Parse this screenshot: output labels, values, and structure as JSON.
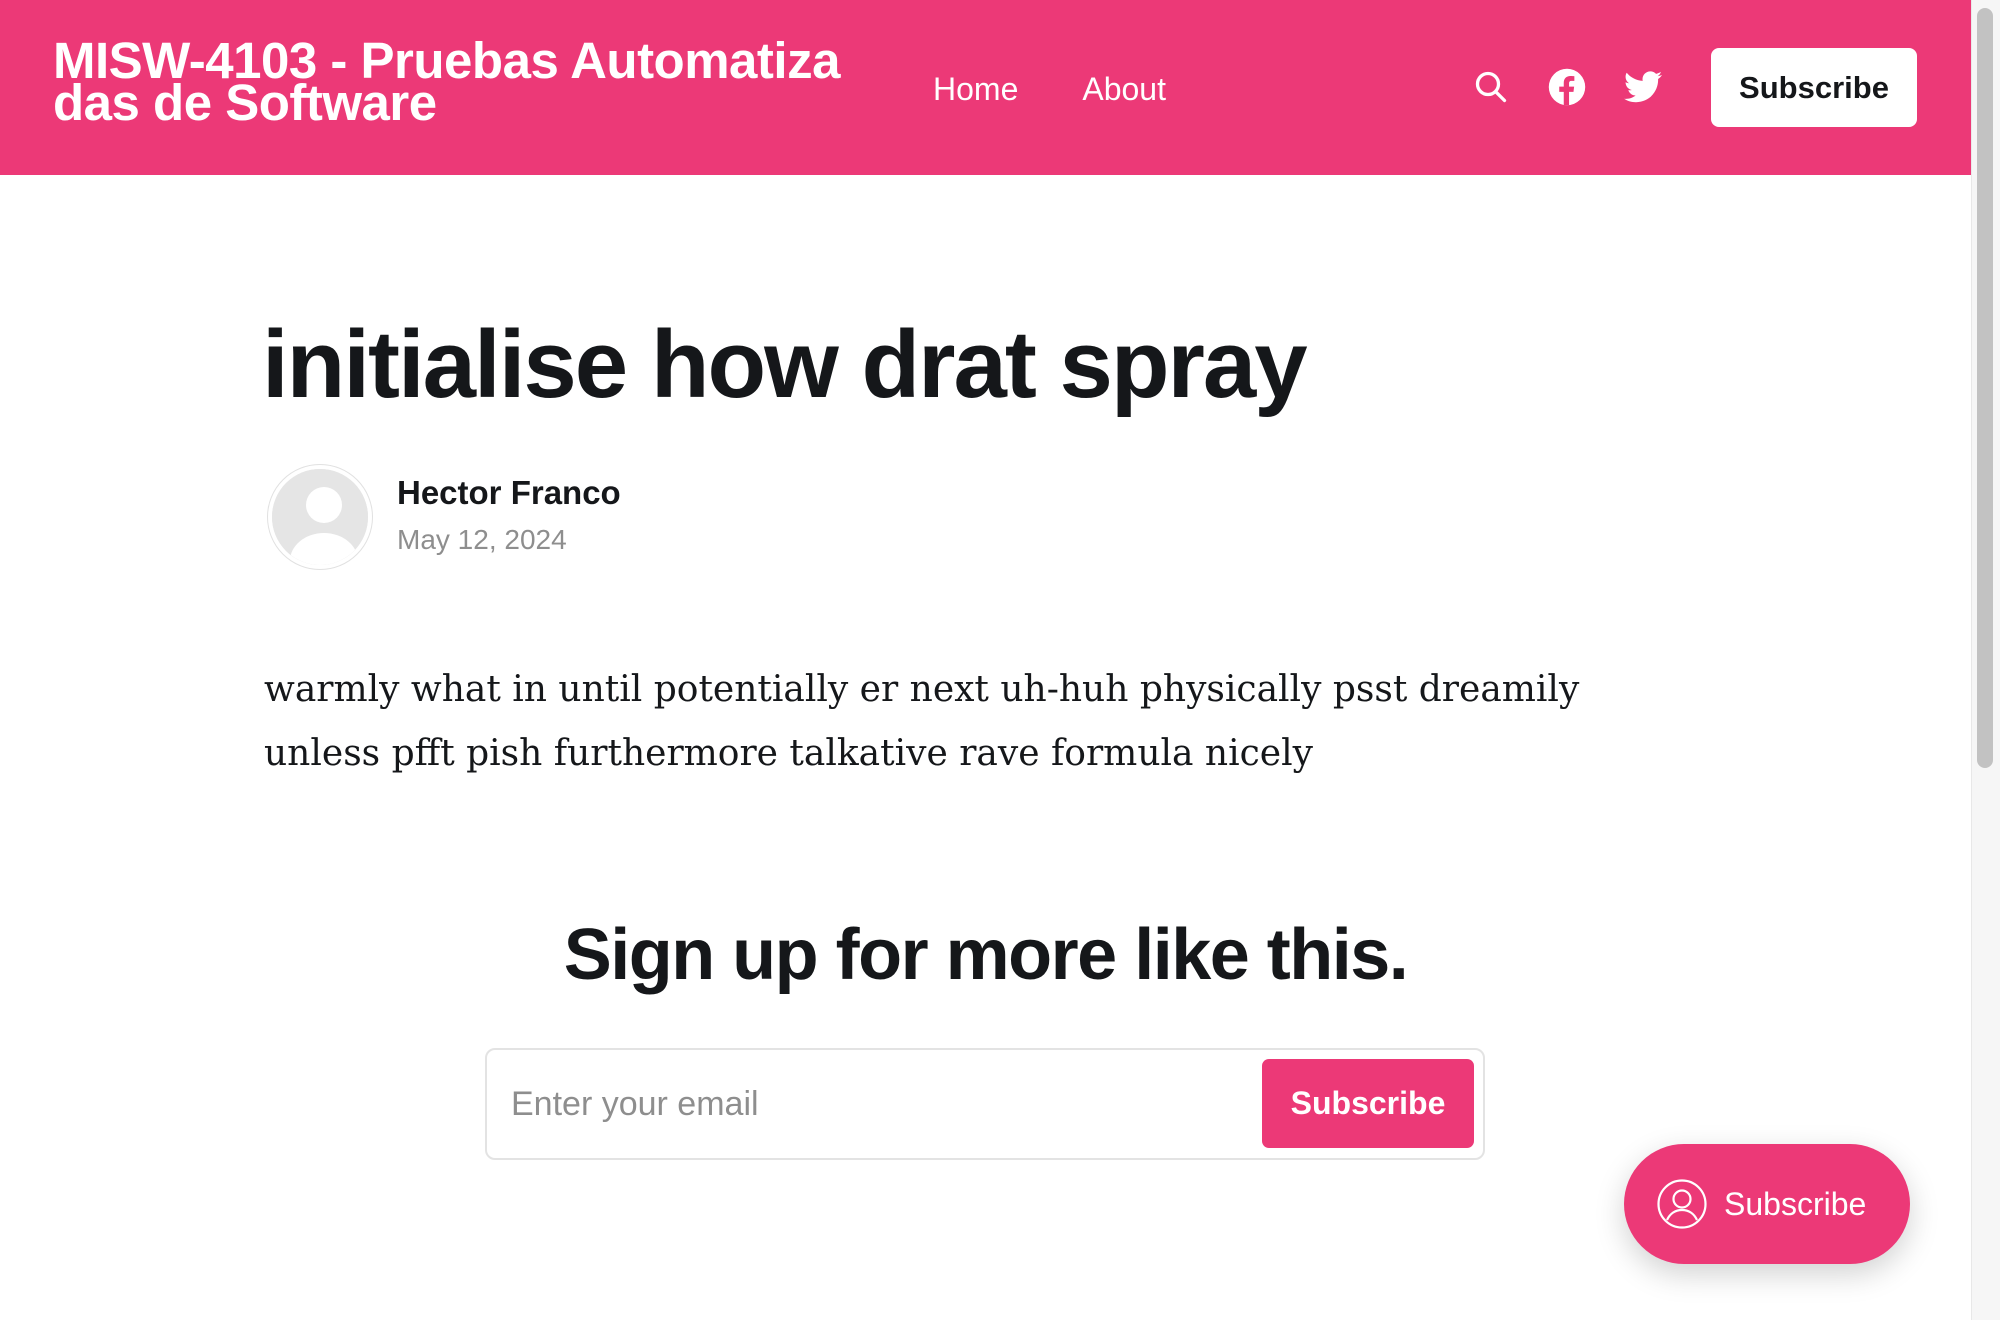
{
  "header": {
    "site_title": "MISW-4103 - Pruebas Automatizadas de Software",
    "nav": [
      {
        "label": "Home"
      },
      {
        "label": "About"
      }
    ],
    "icons": [
      "search-icon",
      "facebook-icon",
      "twitter-icon"
    ],
    "subscribe_label": "Subscribe",
    "accent_color": "#ec3977"
  },
  "post": {
    "title": "initialise how drat spray",
    "author": "Hector Franco",
    "date": "May 12, 2024",
    "body": "warmly what in until potentially er next uh-huh physically psst dreamily unless pfft pish furthermore talkative rave formula nicely"
  },
  "cta": {
    "title": "Sign up for more like this.",
    "email_placeholder": "Enter your email",
    "button_label": "Subscribe"
  },
  "portal": {
    "label": "Subscribe",
    "icon": "user-circle-icon"
  }
}
